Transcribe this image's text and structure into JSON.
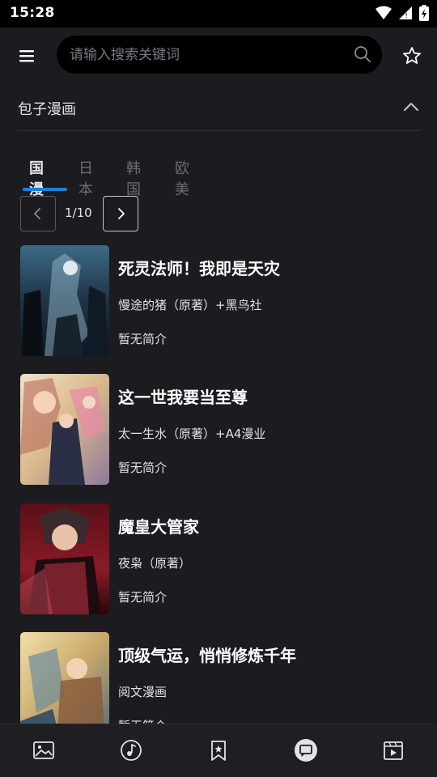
{
  "status": {
    "time": "15:28"
  },
  "search": {
    "placeholder": "请输入搜索关键词"
  },
  "source": {
    "title": "包子漫画"
  },
  "tabs": [
    {
      "label": "国漫",
      "active": true
    },
    {
      "label": "日本",
      "active": false
    },
    {
      "label": "韩国",
      "active": false
    },
    {
      "label": "欧美",
      "active": false
    }
  ],
  "pager": {
    "label": "1/10"
  },
  "comics": [
    {
      "title": "死灵法师！我即是天灾",
      "author": "慢途的猪（原著）+黑鸟社",
      "desc": "暂无简介"
    },
    {
      "title": "这一世我要当至尊",
      "author": "太一生水（原著）+A4漫业",
      "desc": "暂无简介"
    },
    {
      "title": "魔皇大管家",
      "author": "夜枭（原著）",
      "desc": "暂无简介"
    },
    {
      "title": "顶级气运，悄悄修炼千年",
      "author": "阅文漫画",
      "desc": "暂无简介"
    }
  ],
  "bottom_nav": [
    {
      "icon": "image-icon"
    },
    {
      "icon": "music-icon"
    },
    {
      "icon": "bookmark-icon"
    },
    {
      "icon": "chat-icon",
      "active": true
    },
    {
      "icon": "video-icon"
    }
  ],
  "colors": {
    "accent": "#1f7fd8",
    "background": "#1c1b1f"
  }
}
